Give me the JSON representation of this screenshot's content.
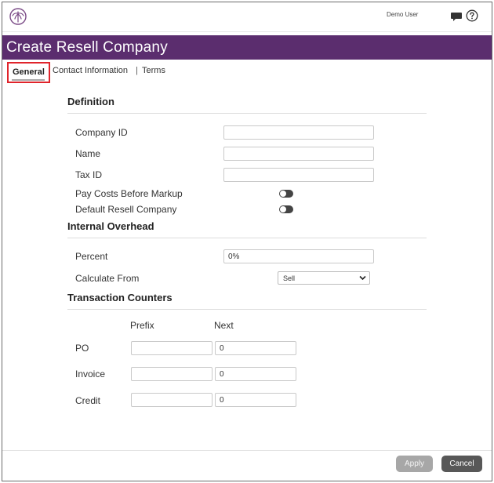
{
  "header": {
    "user_name": "Demo User"
  },
  "page": {
    "title": "Create Resell Company"
  },
  "tabs": [
    {
      "label": "General",
      "active": true
    },
    {
      "label": "Contact Information"
    },
    {
      "label": "Terms"
    }
  ],
  "tab_separator": "|",
  "sections": {
    "definition": {
      "title": "Definition",
      "company_id_label": "Company ID",
      "company_id_value": "",
      "name_label": "Name",
      "name_value": "",
      "tax_id_label": "Tax ID",
      "tax_id_value": "",
      "pay_costs_label": "Pay Costs Before Markup",
      "pay_costs_on": false,
      "default_resell_label": "Default Resell Company",
      "default_resell_on": false
    },
    "overhead": {
      "title": "Internal Overhead",
      "percent_label": "Percent",
      "percent_value": "0%",
      "calculate_from_label": "Calculate From",
      "calculate_from_value": "Sell"
    },
    "counters": {
      "title": "Transaction Counters",
      "prefix_header": "Prefix",
      "next_header": "Next",
      "rows": [
        {
          "label": "PO",
          "prefix": "",
          "next": "0"
        },
        {
          "label": "Invoice",
          "prefix": "",
          "next": "0"
        },
        {
          "label": "Credit",
          "prefix": "",
          "next": "0"
        }
      ]
    }
  },
  "footer": {
    "apply_label": "Apply",
    "cancel_label": "Cancel"
  },
  "colors": {
    "title_bar": "#5b2d6e",
    "active_tab_highlight": "#e0242b",
    "apply_button": "#a7a7a7",
    "cancel_button": "#585858"
  },
  "icons": [
    "palm-logo-icon",
    "chat-icon",
    "help-icon",
    "chevron-down-icon"
  ]
}
